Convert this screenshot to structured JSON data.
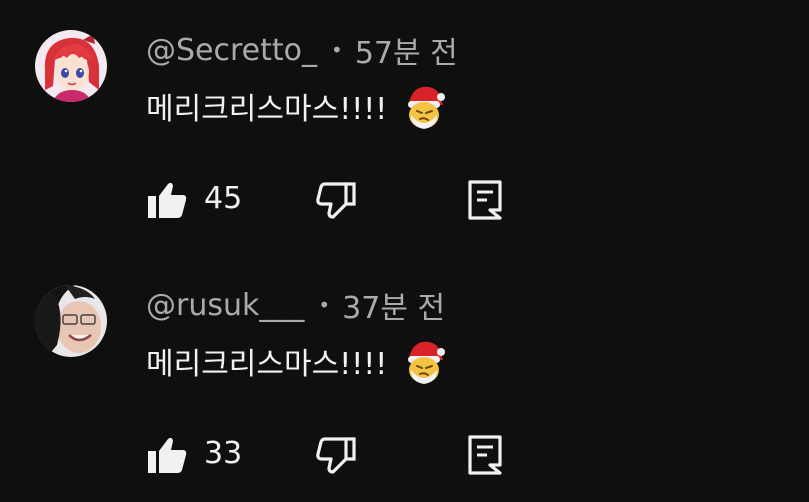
{
  "comments": [
    {
      "author": "@Secretto_",
      "separator": "•",
      "time": "57분 전",
      "text": "메리크리스마스!!!!",
      "emoji": "santa-face-emoji",
      "likes": "45",
      "avatar": "anime-girl-red-hair-avatar"
    },
    {
      "author": "@rusuk___",
      "separator": "•",
      "time": "37분 전",
      "text": "메리크리스마스!!!!",
      "emoji": "santa-face-emoji",
      "likes": "33",
      "avatar": "person-dark-hair-avatar"
    }
  ],
  "icons": {
    "like": "thumbs-up-icon",
    "dislike": "thumbs-down-icon",
    "reply": "reply-comment-icon"
  },
  "colors": {
    "background": "#0f0f0f",
    "primary_text": "#f1f1f1",
    "secondary_text": "#aaaaaa"
  }
}
